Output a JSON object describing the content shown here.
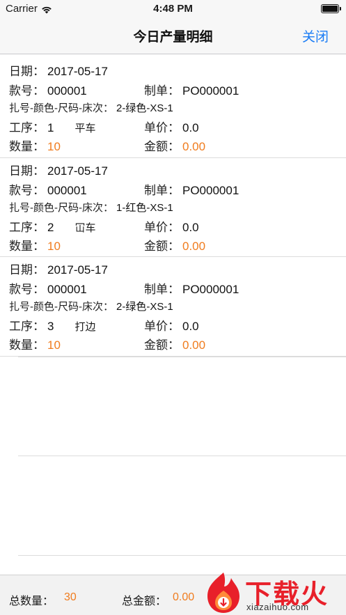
{
  "status_bar": {
    "carrier": "Carrier",
    "time": "4:48 PM"
  },
  "nav": {
    "title": "今日产量明细",
    "close_label": "关闭"
  },
  "labels": {
    "date": "日期：",
    "style_no": "款号：",
    "order_no": "制单：",
    "bundle": "扎号-颜色-尺码-床次：",
    "process": "工序：",
    "unit_price": "单价：",
    "quantity": "数量：",
    "amount": "金额："
  },
  "records": [
    {
      "date": "2017-05-17",
      "style_no": "000001",
      "order_no": "PO000001",
      "bundle": "2-绿色-XS-1",
      "process_no": "1",
      "process_name": "平车",
      "unit_price": "0.0",
      "quantity": "10",
      "amount": "0.00"
    },
    {
      "date": "2017-05-17",
      "style_no": "000001",
      "order_no": "PO000001",
      "bundle": "1-红色-XS-1",
      "process_no": "2",
      "process_name": "冚车",
      "unit_price": "0.0",
      "quantity": "10",
      "amount": "0.00"
    },
    {
      "date": "2017-05-17",
      "style_no": "000001",
      "order_no": "PO000001",
      "bundle": "2-绿色-XS-1",
      "process_no": "3",
      "process_name": "打边",
      "unit_price": "0.0",
      "quantity": "10",
      "amount": "0.00"
    }
  ],
  "footer": {
    "total_qty_label": "总数量：",
    "total_qty": "30",
    "total_amount_label": "总金额：",
    "total_amount": "0.00"
  },
  "watermark": {
    "brand": "下载火",
    "site": "xiazaihuo.com"
  },
  "colors": {
    "accent_blue": "#1a7cf5",
    "value_orange": "#f07c1e",
    "watermark_red": "#e8202a"
  },
  "icons": [
    "wifi-icon",
    "battery-icon",
    "flame-logo-icon"
  ]
}
